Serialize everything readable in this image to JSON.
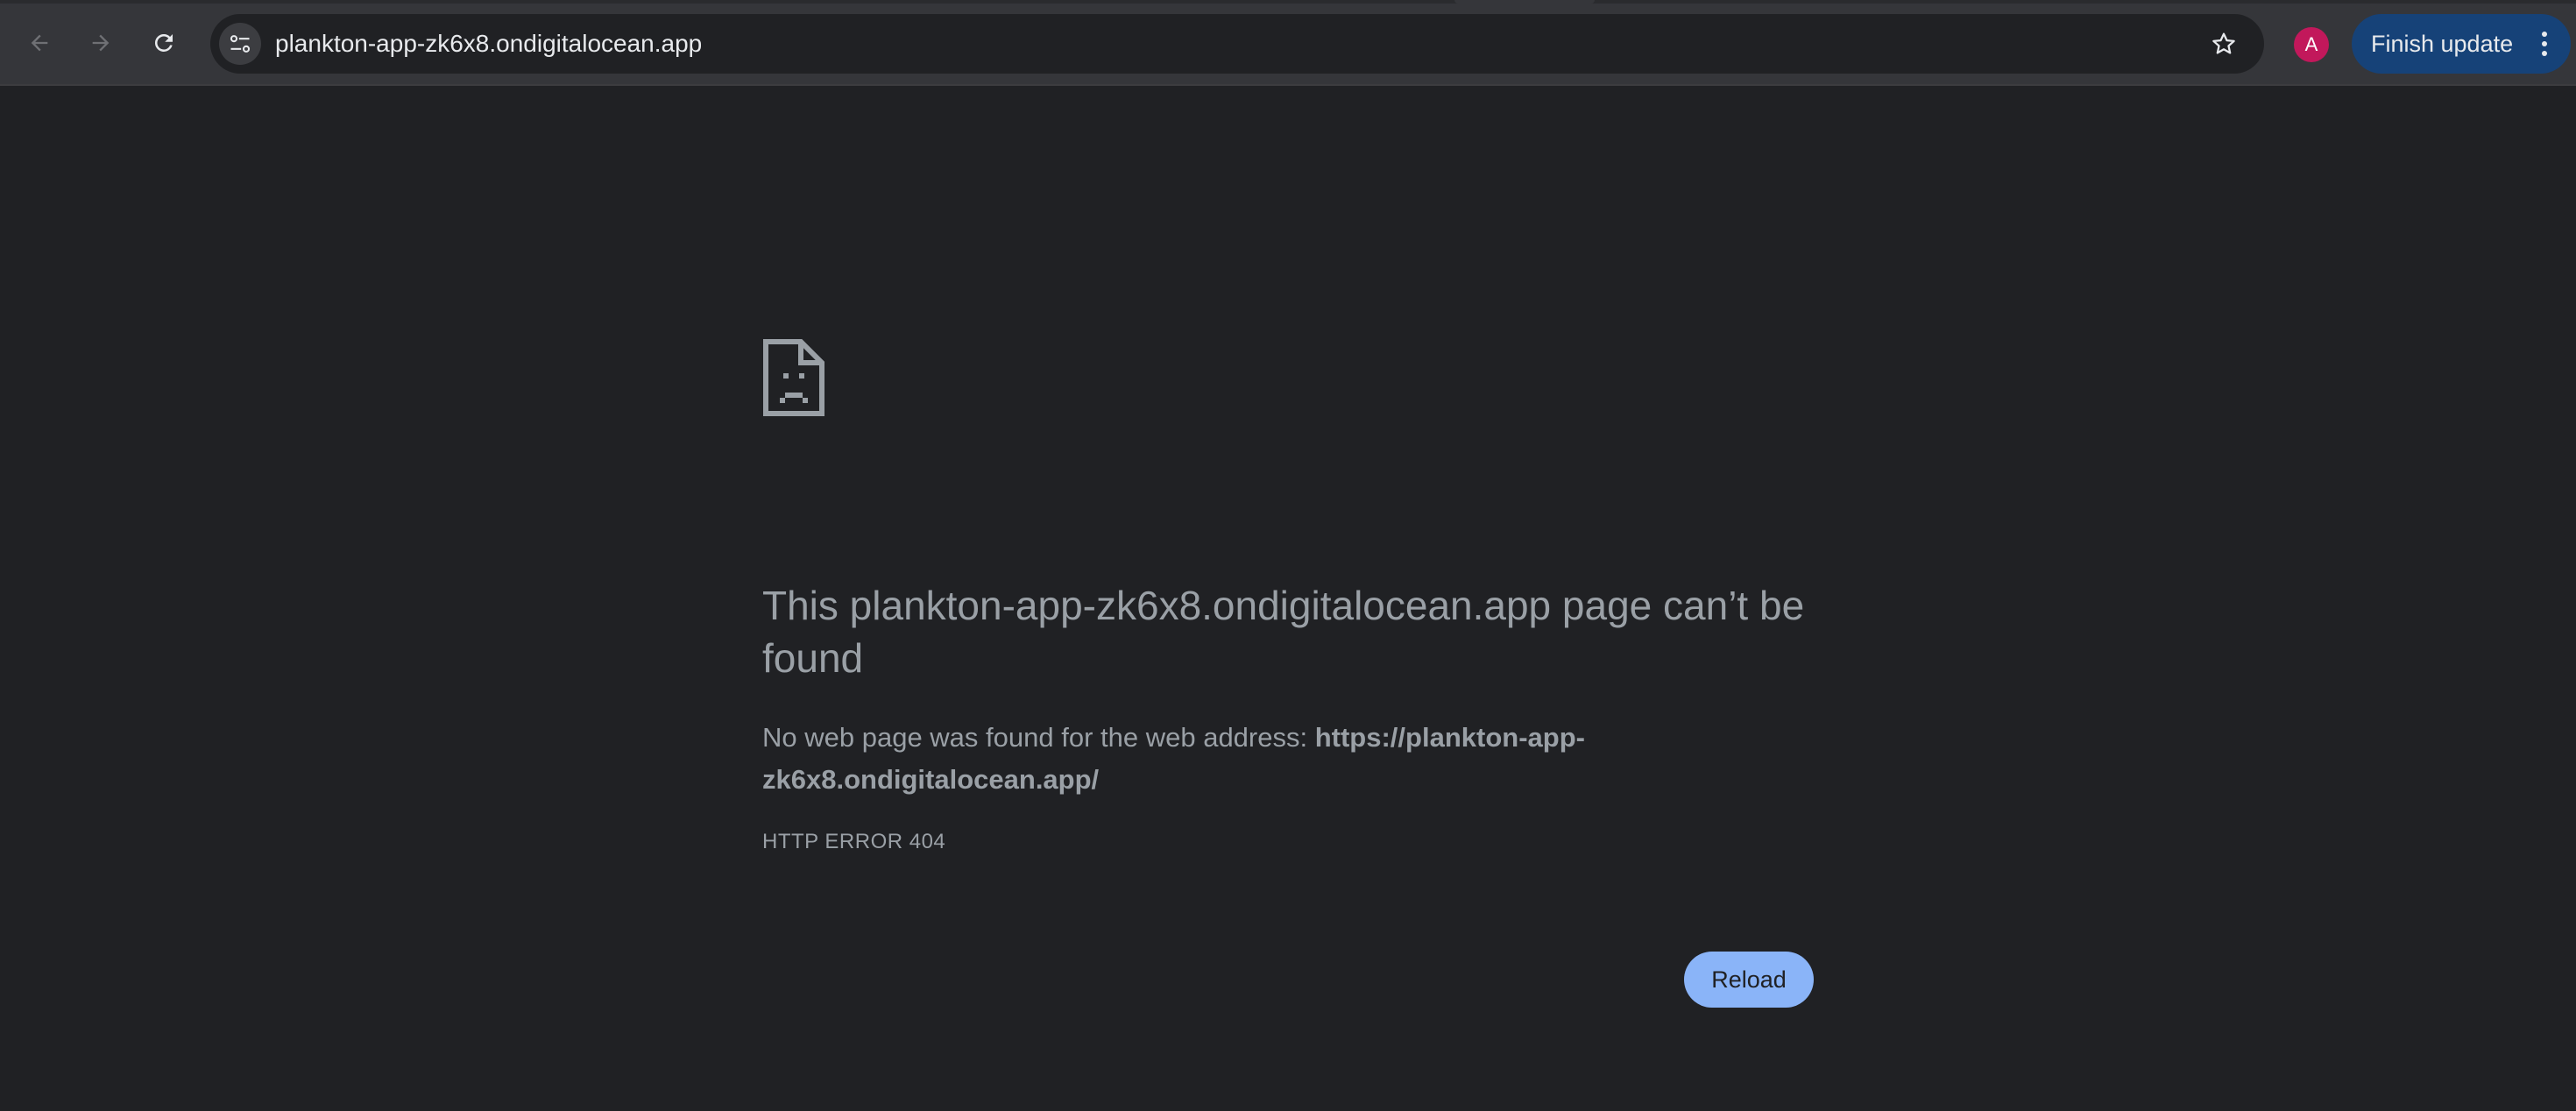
{
  "browser": {
    "url": "plankton-app-zk6x8.ondigitalocean.app",
    "avatar_initial": "A",
    "update_button_label": "Finish update",
    "icons": {
      "back": "arrow-back-icon",
      "forward": "arrow-forward-icon",
      "reload": "reload-icon",
      "site_info": "tune-icon",
      "bookmark": "star-icon",
      "menu": "vertical-dots-icon"
    }
  },
  "error_page": {
    "icon": "sad-page-icon",
    "title": "This plankton-app-zk6x8.ondigitalocean.app page can’t be found",
    "description_prefix": "No web page was found for the web address: ",
    "description_url": "https://plankton-app-zk6x8.ondigitalocean.app/",
    "error_code": "HTTP ERROR 404",
    "reload_label": "Reload"
  },
  "colors": {
    "toolbar_bg": "#35363a",
    "page_bg": "#202124",
    "text_secondary": "#9aa0a6",
    "accent_blue": "#8ab4f8",
    "update_button_bg": "#164278",
    "avatar_bg": "#c2185b"
  }
}
